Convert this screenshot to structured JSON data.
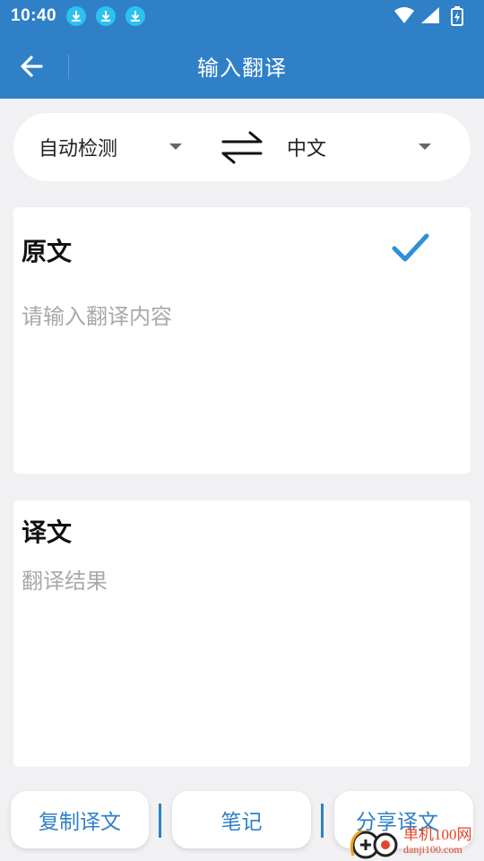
{
  "status_bar": {
    "time": "10:40",
    "icons": [
      "download-icon",
      "download-icon",
      "download-icon",
      "wifi-icon",
      "signal-icon",
      "battery-charging-icon"
    ]
  },
  "app_bar": {
    "title": "输入翻译",
    "back_icon": "arrow-left-icon",
    "background_color": "#2f80c6"
  },
  "language_bar": {
    "source_language": "自动检测",
    "target_language": "中文",
    "swap_icon": "swap-arrows-icon"
  },
  "source_card": {
    "title": "原文",
    "input_placeholder": "请输入翻译内容",
    "input_value": "",
    "confirm_icon": "checkmark-icon",
    "accent_color": "#2f8fd6"
  },
  "result_card": {
    "title": "译文",
    "placeholder": "翻译结果"
  },
  "bottom_actions": {
    "copy_label": "复制译文",
    "note_label": "笔记",
    "share_label": "分享译文"
  },
  "watermark": {
    "brand": "单机100网",
    "domain": "danji100.com"
  }
}
